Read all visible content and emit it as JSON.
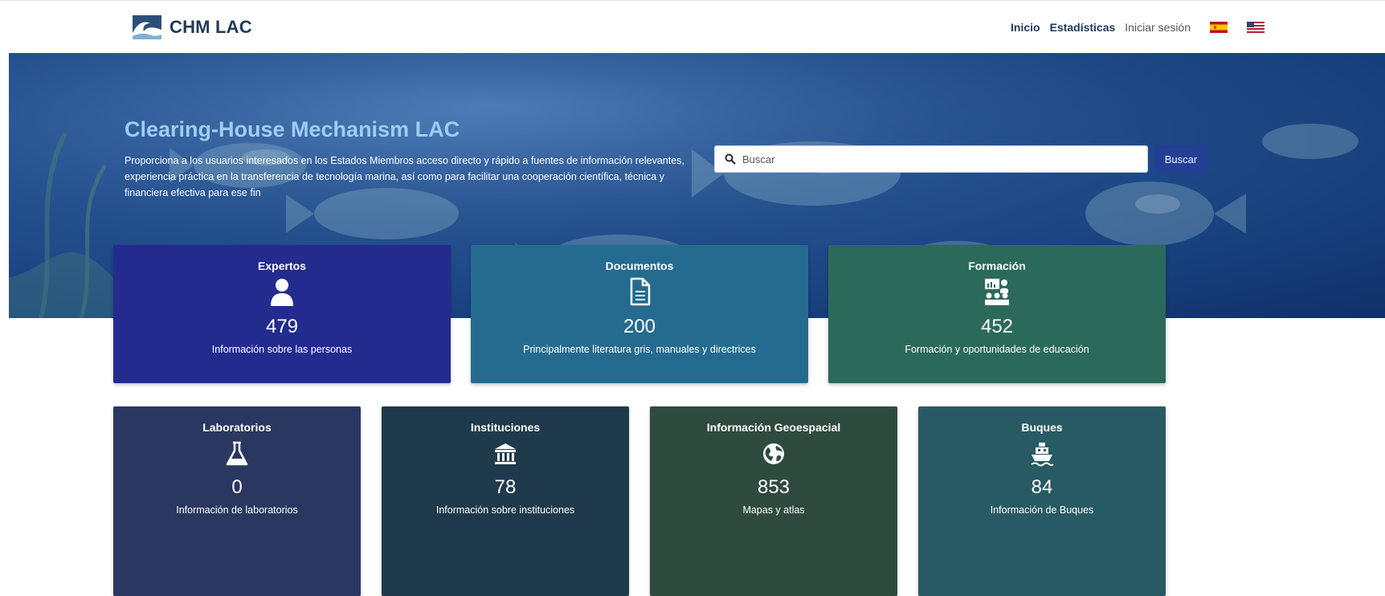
{
  "brand": {
    "name": "CHM LAC"
  },
  "nav": {
    "inicio": "Inicio",
    "estadisticas": "Estadísticas",
    "login": "Iniciar sesión"
  },
  "hero": {
    "title": "Clearing-House Mechanism LAC",
    "description": "Proporciona a los usuarios interesados en los Estados Miembros acceso directo y rápido a fuentes de información relevantes, experiencia práctica en la transferencia de tecnología marina, así como para facilitar una cooperación científica, técnica y financiera efectiva para ese fin",
    "search_placeholder": "Buscar",
    "search_button": "Buscar"
  },
  "cards": [
    {
      "title": "Expertos",
      "icon": "user-icon",
      "count": "479",
      "description": "Información sobre las personas",
      "color": "#232b8e"
    },
    {
      "title": "Documentos",
      "icon": "document-icon",
      "count": "200",
      "description": "Principalmente literatura gris, manuales y directrices",
      "color": "#256b8f"
    },
    {
      "title": "Formación",
      "icon": "training-icon",
      "count": "452",
      "description": "Formación y oportunidades de educación",
      "color": "#2b6a5a"
    },
    {
      "title": "Laboratorios",
      "icon": "flask-icon",
      "count": "0",
      "description": "Información de laboratorios",
      "color": "#2a3760"
    },
    {
      "title": "Instituciones",
      "icon": "institution-icon",
      "count": "78",
      "description": "Información sobre instituciones",
      "color": "#1f3a4a"
    },
    {
      "title": "Información Geoespacial",
      "icon": "globe-icon",
      "count": "853",
      "description": "Mapas y atlas",
      "color": "#2f4b40"
    },
    {
      "title": "Buques",
      "icon": "ship-icon",
      "count": "84",
      "description": "Información de Buques",
      "color": "#285a63"
    }
  ]
}
